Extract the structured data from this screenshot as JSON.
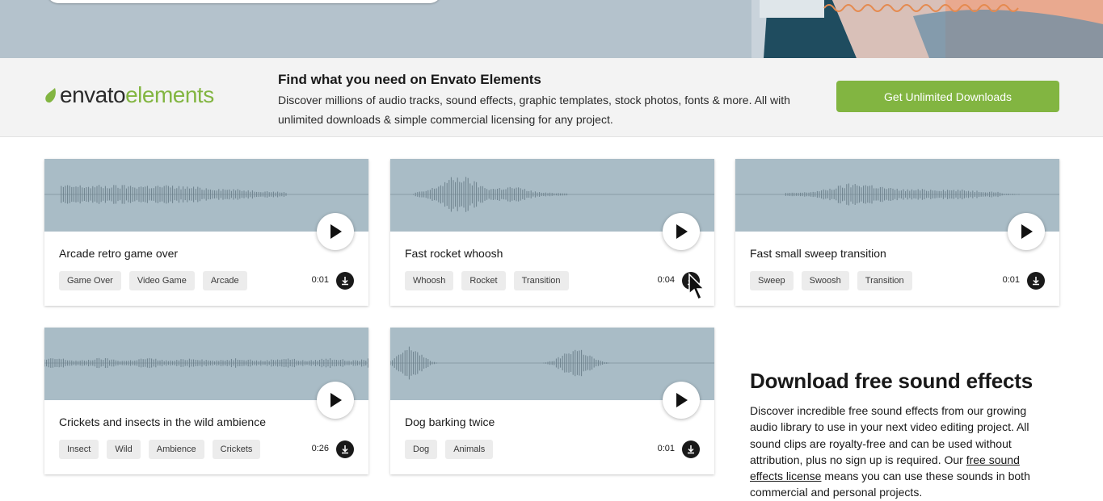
{
  "banner": {
    "logo_word1": "envato",
    "logo_word2": "elements",
    "title": "Find what you need on Envato Elements",
    "description": "Discover millions of audio tracks, sound effects, graphic templates, stock photos, fonts & more. All with unlimited downloads & simple commercial licensing for any project.",
    "cta_label": "Get Unlimited Downloads"
  },
  "cards": [
    {
      "title": "Arcade retro game over",
      "tags": [
        "Game Over",
        "Video Game",
        "Arcade"
      ],
      "duration": "0:01"
    },
    {
      "title": "Fast rocket whoosh",
      "tags": [
        "Whoosh",
        "Rocket",
        "Transition"
      ],
      "duration": "0:04"
    },
    {
      "title": "Fast small sweep transition",
      "tags": [
        "Sweep",
        "Swoosh",
        "Transition"
      ],
      "duration": "0:01"
    },
    {
      "title": "Crickets and insects in the wild ambience",
      "tags": [
        "Insect",
        "Wild",
        "Ambience",
        "Crickets"
      ],
      "duration": "0:26"
    },
    {
      "title": "Dog barking twice",
      "tags": [
        "Dog",
        "Animals"
      ],
      "duration": "0:01"
    }
  ],
  "side": {
    "title": "Download free sound effects",
    "desc_before": "Discover incredible free sound effects from our growing audio library to use in your next video editing project. All sound clips are royalty-free and can be used without attribution, plus no sign up is required. Our ",
    "desc_link": "free sound effects license",
    "desc_after": " means you can use these sounds in both commercial and personal projects."
  },
  "icons": {
    "play": "play-icon",
    "download": "download-icon",
    "leaf": "envato-leaf-icon",
    "cursor": "mouse-cursor-icon"
  },
  "colors": {
    "accent_green": "#82b541",
    "waveform_bg": "#a9bcc6",
    "hero_bg": "#b4c2cc",
    "banner_bg": "#f3f3f3"
  }
}
